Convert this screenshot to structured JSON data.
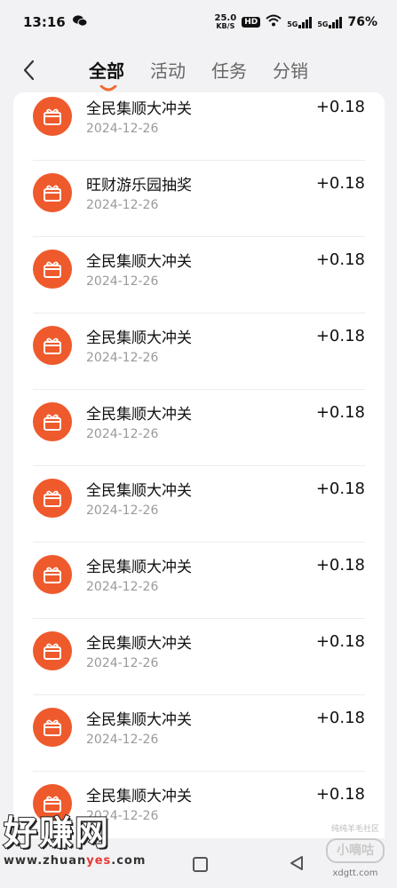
{
  "status_bar": {
    "time": "13:16",
    "net_speed_value": "25.0",
    "net_speed_unit": "KB/S",
    "hd": "HD",
    "signal_1": "5G",
    "signal_2": "5G",
    "battery": "76%"
  },
  "header": {
    "tabs": [
      {
        "label": "全部",
        "active": true
      },
      {
        "label": "活动",
        "active": false
      },
      {
        "label": "任务",
        "active": false
      },
      {
        "label": "分销",
        "active": false
      }
    ]
  },
  "records": [
    {
      "title": "全民集顺大冲关",
      "date": "2024-12-26",
      "amount": "+0.18"
    },
    {
      "title": "旺财游乐园抽奖",
      "date": "2024-12-26",
      "amount": "+0.18"
    },
    {
      "title": "全民集顺大冲关",
      "date": "2024-12-26",
      "amount": "+0.18"
    },
    {
      "title": "全民集顺大冲关",
      "date": "2024-12-26",
      "amount": "+0.18"
    },
    {
      "title": "全民集顺大冲关",
      "date": "2024-12-26",
      "amount": "+0.18"
    },
    {
      "title": "全民集顺大冲关",
      "date": "2024-12-26",
      "amount": "+0.18"
    },
    {
      "title": "全民集顺大冲关",
      "date": "2024-12-26",
      "amount": "+0.18"
    },
    {
      "title": "全民集顺大冲关",
      "date": "2024-12-26",
      "amount": "+0.18"
    },
    {
      "title": "全民集顺大冲关",
      "date": "2024-12-26",
      "amount": "+0.18"
    },
    {
      "title": "全民集顺大冲关",
      "date": "2024-12-26",
      "amount": "+0.18"
    }
  ],
  "watermarks": {
    "left_title": "好赚网",
    "left_url_a": "www.zhuan",
    "left_url_b": "yes",
    "left_url_c": ".com",
    "right_top": "纯纯羊毛社区",
    "right_logo": "小嘀咕",
    "right_url": "xdgtt.com"
  },
  "colors": {
    "accent": "#ee5a2c",
    "tab_underline": "#f26a2e"
  },
  "icons": {
    "back": "chevron-left-icon",
    "record": "gift-icon",
    "nav_home": "square-icon",
    "nav_back": "triangle-back-icon"
  }
}
